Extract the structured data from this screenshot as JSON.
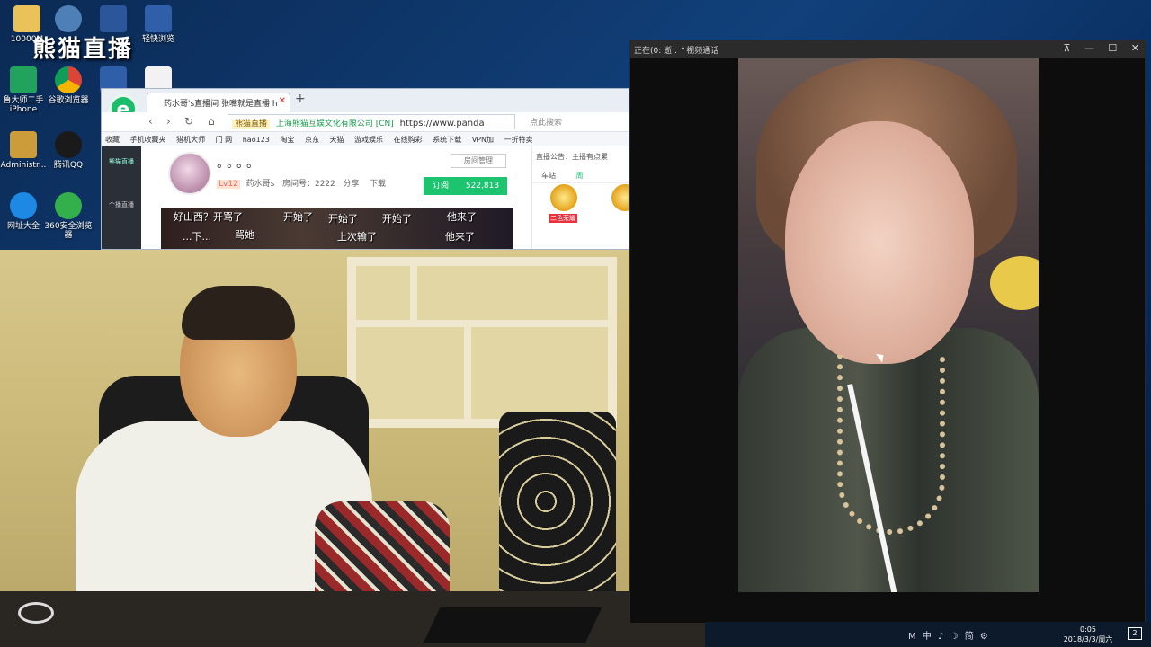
{
  "desktop": {
    "watermark": "熊猫直播",
    "icons": [
      {
        "name": "folder-icon",
        "label": "10000M",
        "color": "#e9c35a"
      },
      {
        "name": "settings-icon",
        "label": "",
        "color": "#4e7fb6"
      },
      {
        "name": "word-icon",
        "label": "",
        "color": "#2b579a"
      },
      {
        "name": "app-kx-icon",
        "label": "轻快浏览",
        "color": "#2f5fa8"
      },
      {
        "name": "app-u-icon",
        "label": "鲁大师二手iPhone",
        "color": "#21a35d"
      },
      {
        "name": "chrome-icon",
        "label": "谷歌浏览器",
        "color": "#db4437"
      },
      {
        "name": "app-kx-icon-2",
        "label": "",
        "color": "#2f5fa8"
      },
      {
        "name": "file-icon",
        "label": "",
        "color": "#f2f2f2"
      },
      {
        "name": "user-icon",
        "label": "Administr...",
        "color": "#cc9b3a"
      },
      {
        "name": "qq-icon",
        "label": "腾讯QQ",
        "color": "#1a1a1a"
      },
      {
        "name": "ie-icon",
        "label": "网址大全",
        "color": "#1e88e5"
      },
      {
        "name": "360-browser-icon",
        "label": "360安全浏览器",
        "color": "#33b04b"
      }
    ]
  },
  "browser": {
    "tab_title": "药水哥's直播间 张嘴就是直播 h",
    "new_tab": "+",
    "addr_tag": "熊猫直播",
    "addr_ssl": "上海熊猫互娱文化有限公司 [CN]",
    "url": "https://www.panda",
    "search_placeholder": "点此搜索",
    "bookmarks": [
      "收藏",
      "手机收藏夹",
      "猎机大师",
      "门 网",
      "hao123",
      "淘宝",
      "京东",
      "天猫",
      "游戏娱乐",
      "在线购彩",
      "系统下载",
      "VPN加",
      "一折特卖"
    ],
    "room": {
      "dots": "。。。。",
      "level": "Lv12",
      "host": "药水哥s",
      "room_id": "房间号：2222",
      "share": "分享",
      "download": "下载",
      "mgmt": "房间管理",
      "subscribe": "订阅",
      "subscribers": "522,813"
    },
    "danmaku": [
      "好山西？开骂了",
      "开始了",
      "开始了",
      "开始了",
      "他来了",
      "...下...",
      "骂她",
      "上次输了",
      "他来了"
    ],
    "side_labels": [
      "熊猫直播",
      "个播直播"
    ],
    "right_panel": {
      "notice": "直播公告：主播有点累",
      "tab1": "车站",
      "tab2": "周",
      "badge": "二色荣耀"
    }
  },
  "video_window": {
    "title": "正在(0: 逝 . ^视频通话",
    "controls": [
      "⊼",
      "—",
      "☐",
      "✕"
    ]
  },
  "taskbar": {
    "tray": "M 中 ♪ ☽ 简 ⚙",
    "time": "0:05",
    "date": "2018/3/3/周六",
    "notify": "2"
  }
}
